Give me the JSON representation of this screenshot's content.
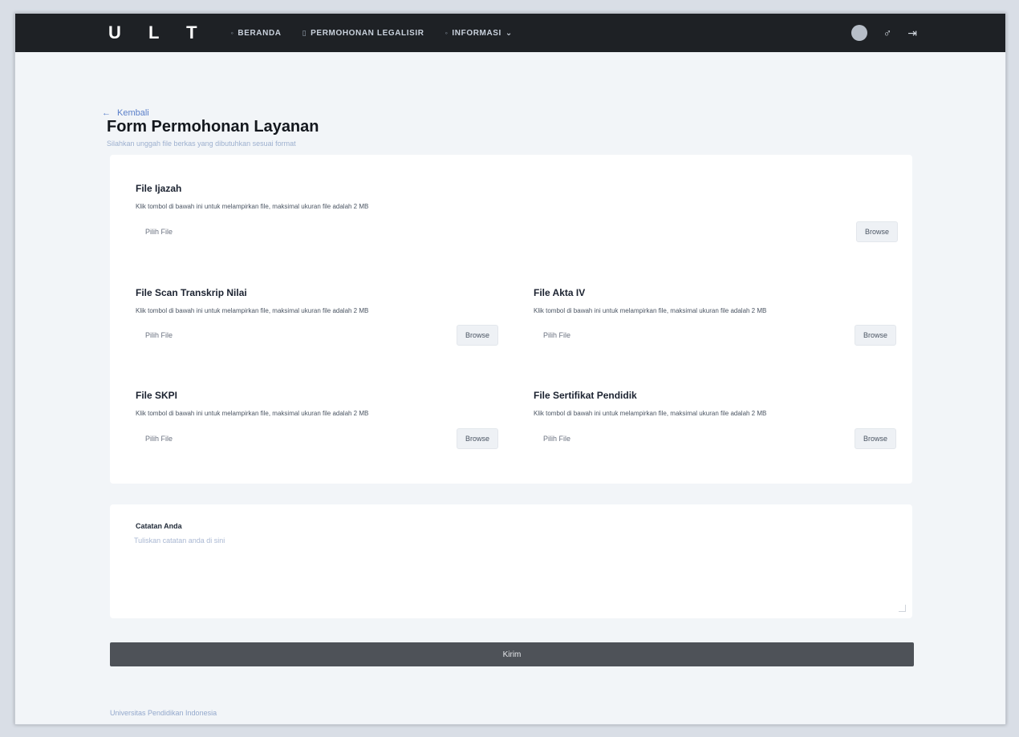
{
  "nav": {
    "logo": "U L T",
    "links": [
      {
        "icon": "◦",
        "label": "BERANDA"
      },
      {
        "icon": "▯",
        "label": "PERMOHONAN LEGALISIR"
      },
      {
        "icon": "◦",
        "label": "INFORMASI",
        "caret": "⌄"
      }
    ],
    "right_icons": {
      "bell": "♂",
      "logout": "⇥"
    }
  },
  "header": {
    "back_label": "Kembali",
    "back_icon": "←",
    "title": "Form Permohonan Layanan",
    "subtitle": "Silahkan unggah file berkas yang dibutuhkan sesuai format"
  },
  "form": {
    "ijazah": {
      "title": "File Ijazah",
      "help": "Klik tombol di bawah ini untuk melampirkan file, maksimal ukuran file adalah 2 MB",
      "placeholder": "Pilih File",
      "browse": "Browse"
    },
    "transkrip": {
      "title": "File Scan Transkrip Nilai",
      "help": "Klik tombol di bawah ini untuk melampirkan file, maksimal ukuran file adalah 2 MB",
      "placeholder": "Pilih File",
      "browse": "Browse"
    },
    "akta": {
      "title": "File Akta IV",
      "help": "Klik tombol di bawah ini untuk melampirkan file, maksimal ukuran file adalah 2 MB",
      "placeholder": "Pilih File",
      "browse": "Browse"
    },
    "skpi": {
      "title": "File SKPI",
      "help": "Klik tombol di bawah ini untuk melampirkan file, maksimal ukuran file adalah 2 MB",
      "placeholder": "Pilih File",
      "browse": "Browse"
    },
    "sertifikat": {
      "title": "File Sertifikat Pendidik",
      "help": "Klik tombol di bawah ini untuk melampirkan file, maksimal ukuran file adalah 2 MB",
      "placeholder": "Pilih File",
      "browse": "Browse"
    }
  },
  "notes": {
    "label": "Catatan Anda",
    "placeholder": "Tuliskan catatan anda di sini"
  },
  "submit_label": "Kirim",
  "footer_text": "Universitas Pendidikan Indonesia"
}
